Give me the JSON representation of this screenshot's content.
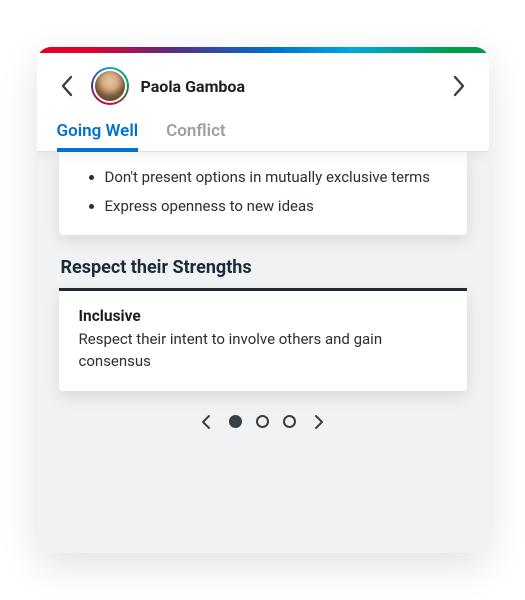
{
  "header": {
    "user_name": "Paola Gamboa"
  },
  "tabs": [
    {
      "label": "Going Well",
      "active": true
    },
    {
      "label": "Conflict",
      "active": false
    }
  ],
  "top_panel": {
    "bullets": [
      "Don't present options in mutually exclusive terms",
      "Express openness to new ideas"
    ]
  },
  "strengths_section": {
    "title": "Respect their Strengths",
    "card": {
      "name": "Inclusive",
      "description": "Respect their intent to involve others and gain consensus"
    }
  },
  "pager": {
    "total": 3,
    "current": 0
  }
}
